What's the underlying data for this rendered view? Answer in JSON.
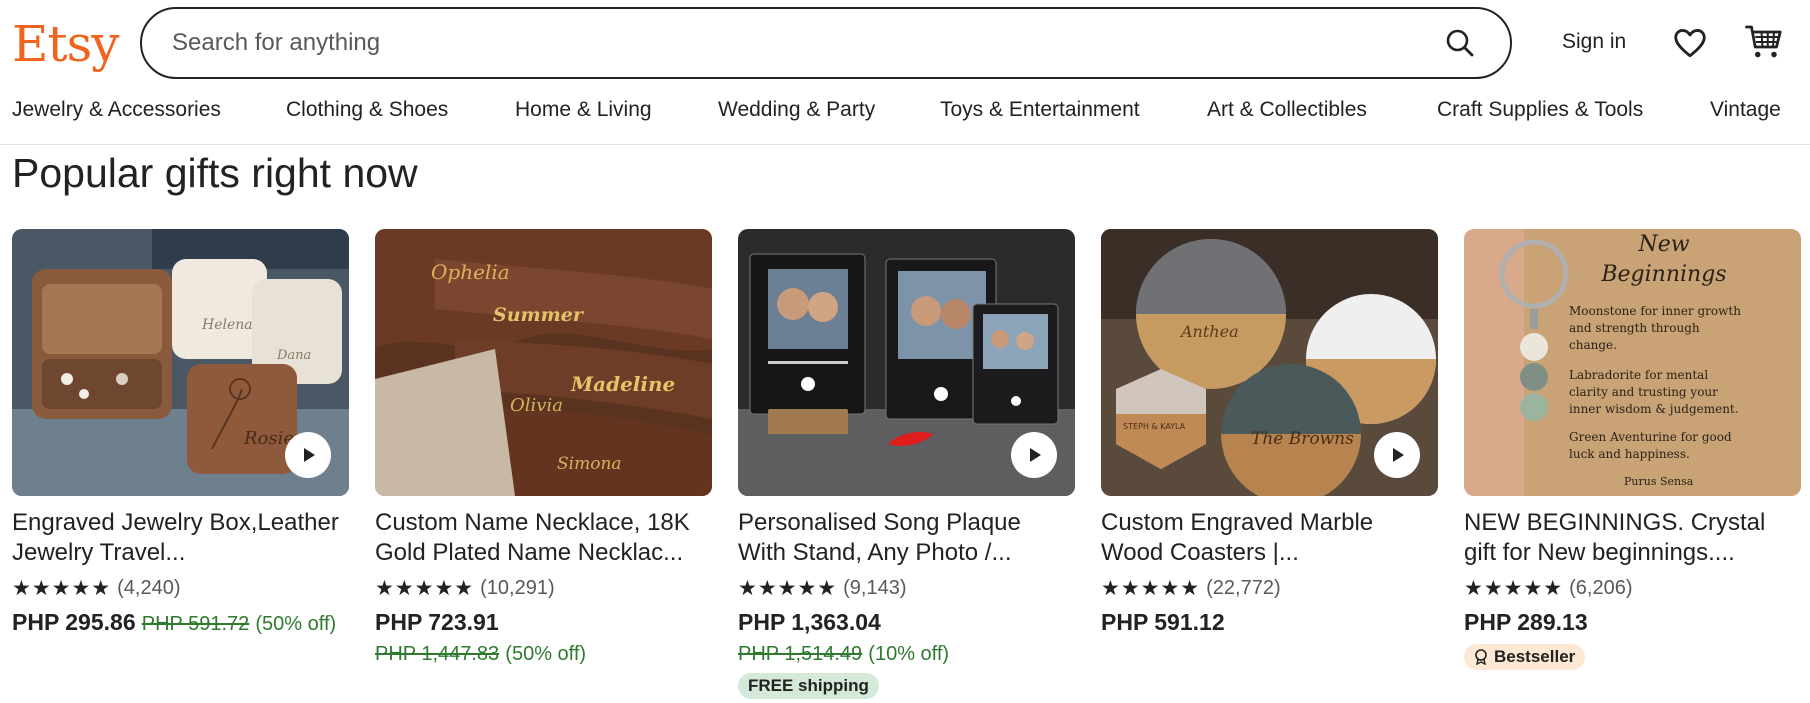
{
  "header": {
    "logo": "Etsy",
    "search_placeholder": "Search for anything",
    "sign_in": "Sign in"
  },
  "categories": [
    "Jewelry & Accessories",
    "Clothing & Shoes",
    "Home & Living",
    "Wedding & Party",
    "Toys & Entertainment",
    "Art & Collectibles",
    "Craft Supplies & Tools",
    "Vintage"
  ],
  "section": {
    "title": "Popular gifts right now"
  },
  "products": [
    {
      "title": "Engraved Jewelry Box,Leather Jewelry Travel...",
      "stars": "★★★★★",
      "reviews": "(4,240)",
      "price": "PHP 295.86",
      "old_price": "PHP 591.72",
      "discount": "(50% off)"
    },
    {
      "title": "Custom Name Necklace, 18K Gold Plated Name Necklac...",
      "stars": "★★★★★",
      "reviews": "(10,291)",
      "price": "PHP 723.91",
      "old_price": "PHP 1,447.83",
      "discount": "(50% off)"
    },
    {
      "title": "Personalised Song Plaque With Stand, Any Photo /...",
      "stars": "★★★★★",
      "reviews": "(9,143)",
      "price": "PHP 1,363.04",
      "old_price": "PHP 1,514.49",
      "discount": "(10% off)",
      "badge": "FREE shipping"
    },
    {
      "title": "Custom Engraved Marble Wood Coasters |...",
      "stars": "★★★★★",
      "reviews": "(22,772)",
      "price": "PHP 591.12"
    },
    {
      "title": "NEW BEGINNINGS. Crystal gift for New beginnings....",
      "stars": "★★★★★",
      "reviews": "(6,206)",
      "price": "PHP 289.13",
      "badge": "Bestseller"
    }
  ],
  "image_text": {
    "p2_names": [
      "Ophelia",
      "Summer",
      "Madeline",
      "Olivia",
      "Simona"
    ],
    "p5_card": {
      "heading_1": "New",
      "heading_2": "Beginnings",
      "line_1": "Moonstone for inner growth",
      "line_2": "and strength through",
      "line_3": "change.",
      "line_4": "Labradorite for mental",
      "line_5": "clarity and trusting your",
      "line_6": "inner wisdom & judgement.",
      "line_7": "Green Aventurine for good",
      "line_8": "luck and happiness.",
      "signature": "Purus Sensa"
    },
    "p4_coasters": [
      "Anthea",
      "The Browns",
      "STEPH & KAYLA"
    ]
  },
  "colors": {
    "brand": "#F1641E",
    "sale_green": "#2F7A2F",
    "free_shipping_bg": "#d4e9d7",
    "bestseller_bg": "#fde8d3"
  }
}
